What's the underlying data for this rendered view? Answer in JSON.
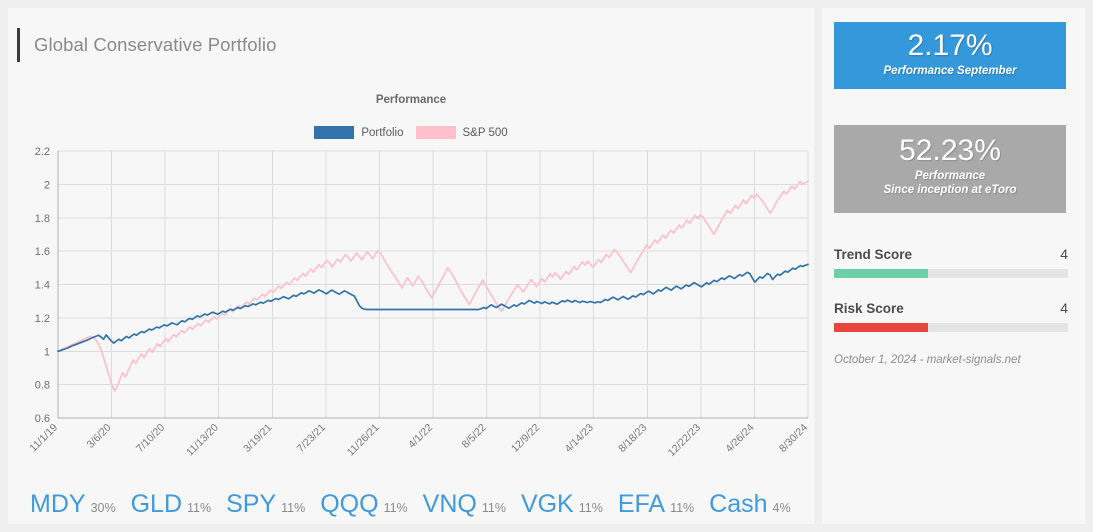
{
  "header": {
    "title": "Global Conservative Portfolio"
  },
  "chart_data": {
    "type": "line",
    "title": "Performance",
    "xlabel": "",
    "ylabel": "",
    "grid": true,
    "legend_position": "top-center",
    "ylim": [
      0.6,
      2.2
    ],
    "yticks": [
      "0.6",
      "0.8",
      "1",
      "1.2",
      "1.4",
      "1.6",
      "1.8",
      "2",
      "2.2"
    ],
    "xticks": [
      "11/1/19",
      "3/6/20",
      "7/10/20",
      "11/13/20",
      "3/19/21",
      "7/23/21",
      "11/26/21",
      "4/1/22",
      "8/5/22",
      "12/9/22",
      "4/14/23",
      "8/18/23",
      "12/22/23",
      "4/26/24",
      "8/30/24"
    ],
    "colors": {
      "portfolio": "#3273ac",
      "sp500": "#ffc0cb"
    },
    "series": [
      {
        "name": "Portfolio",
        "color": "#3273ac",
        "values": [
          1.0,
          1.004,
          1.01,
          1.015,
          1.021,
          1.028,
          1.035,
          1.04,
          1.046,
          1.052,
          1.058,
          1.063,
          1.07,
          1.078,
          1.084,
          1.09,
          1.096,
          1.085,
          1.072,
          1.098,
          1.08,
          1.062,
          1.049,
          1.06,
          1.072,
          1.063,
          1.076,
          1.088,
          1.08,
          1.092,
          1.103,
          1.096,
          1.108,
          1.118,
          1.112,
          1.122,
          1.133,
          1.127,
          1.136,
          1.145,
          1.14,
          1.15,
          1.158,
          1.152,
          1.161,
          1.17,
          1.164,
          1.159,
          1.172,
          1.183,
          1.176,
          1.188,
          1.197,
          1.191,
          1.202,
          1.212,
          1.206,
          1.214,
          1.223,
          1.217,
          1.226,
          1.234,
          1.228,
          1.222,
          1.231,
          1.24,
          1.234,
          1.243,
          1.252,
          1.246,
          1.254,
          1.262,
          1.256,
          1.265,
          1.273,
          1.268,
          1.276,
          1.284,
          1.278,
          1.286,
          1.294,
          1.288,
          1.297,
          1.305,
          1.299,
          1.308,
          1.316,
          1.31,
          1.318,
          1.327,
          1.321,
          1.314,
          1.325,
          1.336,
          1.329,
          1.34,
          1.35,
          1.344,
          1.352,
          1.362,
          1.356,
          1.348,
          1.358,
          1.368,
          1.36,
          1.352,
          1.344,
          1.356,
          1.366,
          1.358,
          1.35,
          1.342,
          1.352,
          1.362,
          1.355,
          1.346,
          1.338,
          1.33,
          1.3,
          1.272,
          1.258,
          1.252,
          1.25,
          1.25,
          1.25,
          1.25,
          1.25,
          1.25,
          1.25,
          1.25,
          1.25,
          1.25,
          1.25,
          1.25,
          1.25,
          1.25,
          1.25,
          1.25,
          1.25,
          1.25,
          1.25,
          1.25,
          1.25,
          1.25,
          1.25,
          1.25,
          1.25,
          1.25,
          1.25,
          1.25,
          1.25,
          1.25,
          1.25,
          1.25,
          1.25,
          1.25,
          1.25,
          1.25,
          1.25,
          1.25,
          1.25,
          1.25,
          1.25,
          1.25,
          1.25,
          1.25,
          1.25,
          1.255,
          1.262,
          1.256,
          1.268,
          1.278,
          1.27,
          1.262,
          1.272,
          1.282,
          1.275,
          1.266,
          1.258,
          1.268,
          1.278,
          1.27,
          1.28,
          1.29,
          1.283,
          1.294,
          1.304,
          1.297,
          1.288,
          1.298,
          1.292,
          1.286,
          1.296,
          1.29,
          1.284,
          1.294,
          1.288,
          1.282,
          1.292,
          1.302,
          1.296,
          1.306,
          1.3,
          1.294,
          1.304,
          1.298,
          1.292,
          1.3,
          1.296,
          1.292,
          1.298,
          1.294,
          1.29,
          1.296,
          1.292,
          1.3,
          1.31,
          1.304,
          1.314,
          1.324,
          1.317,
          1.308,
          1.318,
          1.328,
          1.32,
          1.312,
          1.322,
          1.332,
          1.325,
          1.336,
          1.346,
          1.339,
          1.35,
          1.36,
          1.353,
          1.344,
          1.356,
          1.368,
          1.36,
          1.372,
          1.383,
          1.375,
          1.366,
          1.378,
          1.39,
          1.382,
          1.374,
          1.386,
          1.397,
          1.389,
          1.4,
          1.411,
          1.403,
          1.394,
          1.386,
          1.398,
          1.41,
          1.402,
          1.414,
          1.425,
          1.417,
          1.428,
          1.439,
          1.431,
          1.442,
          1.452,
          1.444,
          1.436,
          1.448,
          1.459,
          1.451,
          1.462,
          1.473,
          1.466,
          1.44,
          1.414,
          1.43,
          1.446,
          1.438,
          1.452,
          1.466,
          1.458,
          1.43,
          1.446,
          1.462,
          1.455,
          1.468,
          1.48,
          1.474,
          1.486,
          1.498,
          1.492,
          1.503,
          1.513,
          1.508,
          1.516,
          1.52
        ]
      },
      {
        "name": "S&P 500",
        "color": "#ffc0cb",
        "values": [
          1.0,
          1.008,
          1.016,
          1.022,
          1.03,
          1.038,
          1.045,
          1.052,
          1.06,
          1.068,
          1.074,
          1.082,
          1.09,
          1.084,
          1.07,
          1.045,
          1.01,
          0.96,
          0.905,
          0.855,
          0.8,
          0.762,
          0.79,
          0.83,
          0.872,
          0.845,
          0.88,
          0.915,
          0.948,
          0.925,
          0.958,
          0.985,
          0.962,
          0.99,
          1.015,
          0.995,
          1.02,
          1.045,
          1.028,
          1.052,
          1.075,
          1.058,
          1.08,
          1.1,
          1.086,
          1.106,
          1.124,
          1.11,
          1.128,
          1.145,
          1.132,
          1.15,
          1.166,
          1.152,
          1.17,
          1.186,
          1.174,
          1.19,
          1.206,
          1.194,
          1.212,
          1.228,
          1.216,
          1.234,
          1.25,
          1.238,
          1.256,
          1.272,
          1.26,
          1.278,
          1.295,
          1.282,
          1.3,
          1.318,
          1.305,
          1.324,
          1.342,
          1.33,
          1.348,
          1.366,
          1.352,
          1.372,
          1.39,
          1.376,
          1.396,
          1.414,
          1.4,
          1.42,
          1.44,
          1.425,
          1.446,
          1.466,
          1.45,
          1.472,
          1.492,
          1.476,
          1.498,
          1.518,
          1.502,
          1.524,
          1.545,
          1.528,
          1.505,
          1.53,
          1.552,
          1.535,
          1.558,
          1.58,
          1.562,
          1.54,
          1.565,
          1.588,
          1.57,
          1.548,
          1.572,
          1.596,
          1.578,
          1.555,
          1.58,
          1.604,
          1.586,
          1.56,
          1.53,
          1.505,
          1.48,
          1.455,
          1.43,
          1.405,
          1.38,
          1.41,
          1.44,
          1.418,
          1.392,
          1.42,
          1.45,
          1.428,
          1.4,
          1.372,
          1.345,
          1.32,
          1.35,
          1.38,
          1.41,
          1.44,
          1.47,
          1.5,
          1.478,
          1.45,
          1.42,
          1.39,
          1.36,
          1.332,
          1.305,
          1.28,
          1.31,
          1.34,
          1.37,
          1.4,
          1.425,
          1.398,
          1.37,
          1.342,
          1.315,
          1.288,
          1.262,
          1.24,
          1.268,
          1.296,
          1.324,
          1.35,
          1.376,
          1.4,
          1.378,
          1.355,
          1.38,
          1.405,
          1.43,
          1.41,
          1.388,
          1.412,
          1.436,
          1.415,
          1.44,
          1.465,
          1.445,
          1.47,
          1.452,
          1.432,
          1.455,
          1.478,
          1.46,
          1.484,
          1.508,
          1.488,
          1.512,
          1.536,
          1.516,
          1.54,
          1.522,
          1.502,
          1.526,
          1.55,
          1.532,
          1.556,
          1.58,
          1.562,
          1.586,
          1.61,
          1.592,
          1.57,
          1.546,
          1.52,
          1.496,
          1.472,
          1.5,
          1.528,
          1.556,
          1.584,
          1.61,
          1.636,
          1.618,
          1.642,
          1.666,
          1.648,
          1.672,
          1.696,
          1.678,
          1.702,
          1.726,
          1.708,
          1.732,
          1.756,
          1.738,
          1.762,
          1.786,
          1.766,
          1.79,
          1.814,
          1.794,
          1.818,
          1.8,
          1.778,
          1.752,
          1.726,
          1.7,
          1.73,
          1.76,
          1.79,
          1.818,
          1.845,
          1.826,
          1.85,
          1.874,
          1.855,
          1.88,
          1.905,
          1.885,
          1.91,
          1.935,
          1.915,
          1.94,
          1.922,
          1.9,
          1.876,
          1.85,
          1.826,
          1.856,
          1.886,
          1.912,
          1.936,
          1.96,
          1.942,
          1.966,
          1.99,
          1.972,
          1.996,
          2.018,
          2.0,
          2.01,
          2.02
        ]
      }
    ]
  },
  "stats": {
    "primary": {
      "value": "2.17%",
      "caption": "Performance September",
      "color": "#3498db"
    },
    "secondary": {
      "value": "52.23%",
      "caption_line1": "Performance",
      "caption_line2": "Since inception at eToro",
      "color": "#a9a9a9"
    }
  },
  "scores": [
    {
      "label": "Trend Score",
      "value": "4",
      "percent": 40,
      "color": "#6ccfaa"
    },
    {
      "label": "Risk Score",
      "value": "4",
      "percent": 40,
      "color": "#e8453c"
    }
  ],
  "footer": {
    "note": "October 1, 2024 - market-signals.net"
  },
  "holdings": [
    {
      "symbol": "MDY",
      "weight": "30%"
    },
    {
      "symbol": "GLD",
      "weight": "11%"
    },
    {
      "symbol": "SPY",
      "weight": "11%"
    },
    {
      "symbol": "QQQ",
      "weight": "11%"
    },
    {
      "symbol": "VNQ",
      "weight": "11%"
    },
    {
      "symbol": "VGK",
      "weight": "11%"
    },
    {
      "symbol": "EFA",
      "weight": "11%"
    },
    {
      "symbol": "Cash",
      "weight": "4%"
    }
  ]
}
